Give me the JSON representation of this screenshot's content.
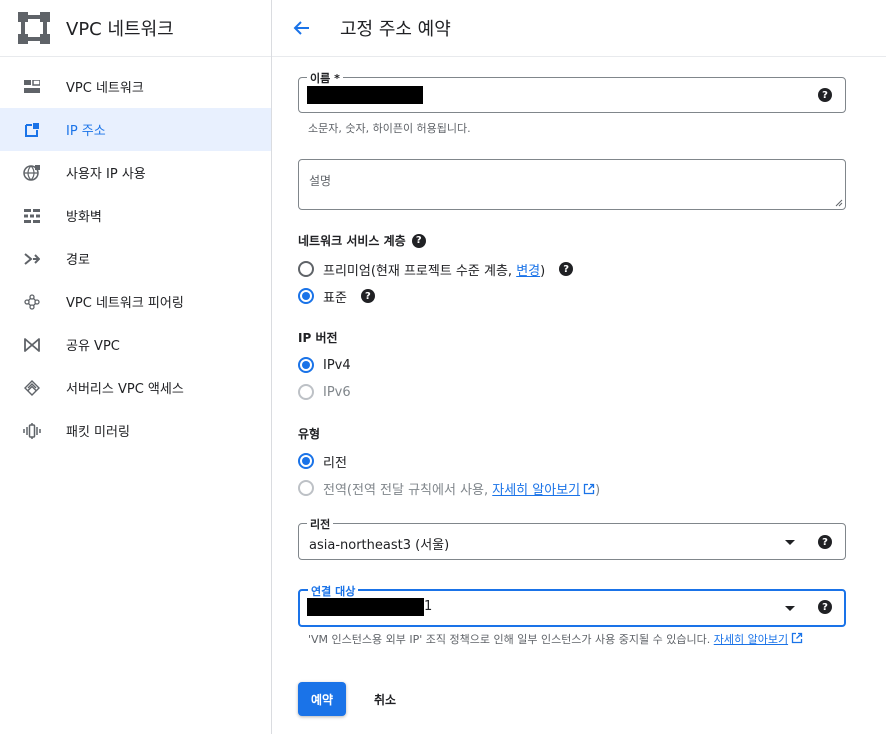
{
  "sidebar": {
    "title": "VPC 네트워크",
    "logo_icon": "vpc-network-icon",
    "items": [
      {
        "label": "VPC 네트워크",
        "icon": "vpc-network-icon"
      },
      {
        "label": "IP 주소",
        "icon": "ip-address-icon",
        "active": true
      },
      {
        "label": "사용자 IP 사용",
        "icon": "globe-icon"
      },
      {
        "label": "방화벽",
        "icon": "firewall-icon"
      },
      {
        "label": "경로",
        "icon": "routes-icon"
      },
      {
        "label": "VPC 네트워크 피어링",
        "icon": "peering-icon"
      },
      {
        "label": "공유 VPC",
        "icon": "shared-vpc-icon"
      },
      {
        "label": "서버리스 VPC 액세스",
        "icon": "serverless-icon"
      },
      {
        "label": "패킷 미러링",
        "icon": "packet-mirroring-icon"
      }
    ]
  },
  "header": {
    "back_icon": "arrow-left-icon",
    "title": "고정 주소 예약"
  },
  "form": {
    "name": {
      "label": "이름 *",
      "value": "[redacted]",
      "hint": "소문자, 숫자, 하이픈이 허용됩니다."
    },
    "description": {
      "placeholder": "설명"
    },
    "network_tier": {
      "title": "네트워크 서비스 계층",
      "premium": {
        "label_prefix": "프리미엄(현재 프로젝트 수준 계층, ",
        "link": "변경",
        "label_suffix": ")",
        "checked": false
      },
      "standard": {
        "label": "표준",
        "checked": true
      }
    },
    "ip_version": {
      "title": "IP 버전",
      "ipv4": {
        "label": "IPv4",
        "checked": true
      },
      "ipv6": {
        "label": "IPv6",
        "checked": false,
        "disabled": true
      }
    },
    "type": {
      "title": "유형",
      "regional": {
        "label": "리전",
        "checked": true
      },
      "global": {
        "label_prefix": "전역(전역 전달 규칙에서 사용, ",
        "link": "자세히 알아보기",
        "label_suffix": ")",
        "checked": false,
        "disabled": true
      }
    },
    "region": {
      "label": "리전",
      "value": "asia-northeast3 (서울)"
    },
    "attached_to": {
      "label": "연결 대상",
      "value_suffix": "1",
      "warning": "'VM 인스턴스용 외부 IP' 조직 정책으로 인해 일부 인스턴스가 사용 중지될 수 있습니다. ",
      "warning_link": "자세히 알아보기"
    }
  },
  "actions": {
    "reserve": "예약",
    "cancel": "취소"
  },
  "colors": {
    "accent": "#1a73e8",
    "active_bg": "#e8f0fe",
    "text": "#202124",
    "muted": "#5f6368"
  }
}
